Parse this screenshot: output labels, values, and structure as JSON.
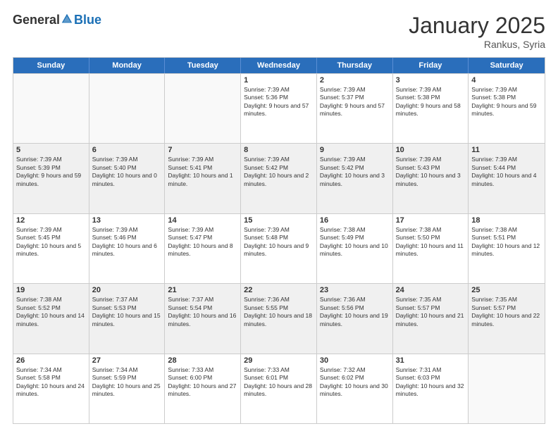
{
  "header": {
    "logo": {
      "general": "General",
      "blue": "Blue"
    },
    "title": "January 2025",
    "location": "Rankus, Syria"
  },
  "weekdays": [
    "Sunday",
    "Monday",
    "Tuesday",
    "Wednesday",
    "Thursday",
    "Friday",
    "Saturday"
  ],
  "rows": [
    [
      {
        "day": "",
        "sunrise": "",
        "sunset": "",
        "daylight": "",
        "empty": true
      },
      {
        "day": "",
        "sunrise": "",
        "sunset": "",
        "daylight": "",
        "empty": true
      },
      {
        "day": "",
        "sunrise": "",
        "sunset": "",
        "daylight": "",
        "empty": true
      },
      {
        "day": "1",
        "sunrise": "Sunrise: 7:39 AM",
        "sunset": "Sunset: 5:36 PM",
        "daylight": "Daylight: 9 hours and 57 minutes."
      },
      {
        "day": "2",
        "sunrise": "Sunrise: 7:39 AM",
        "sunset": "Sunset: 5:37 PM",
        "daylight": "Daylight: 9 hours and 57 minutes."
      },
      {
        "day": "3",
        "sunrise": "Sunrise: 7:39 AM",
        "sunset": "Sunset: 5:38 PM",
        "daylight": "Daylight: 9 hours and 58 minutes."
      },
      {
        "day": "4",
        "sunrise": "Sunrise: 7:39 AM",
        "sunset": "Sunset: 5:38 PM",
        "daylight": "Daylight: 9 hours and 59 minutes."
      }
    ],
    [
      {
        "day": "5",
        "sunrise": "Sunrise: 7:39 AM",
        "sunset": "Sunset: 5:39 PM",
        "daylight": "Daylight: 9 hours and 59 minutes."
      },
      {
        "day": "6",
        "sunrise": "Sunrise: 7:39 AM",
        "sunset": "Sunset: 5:40 PM",
        "daylight": "Daylight: 10 hours and 0 minutes."
      },
      {
        "day": "7",
        "sunrise": "Sunrise: 7:39 AM",
        "sunset": "Sunset: 5:41 PM",
        "daylight": "Daylight: 10 hours and 1 minute."
      },
      {
        "day": "8",
        "sunrise": "Sunrise: 7:39 AM",
        "sunset": "Sunset: 5:42 PM",
        "daylight": "Daylight: 10 hours and 2 minutes."
      },
      {
        "day": "9",
        "sunrise": "Sunrise: 7:39 AM",
        "sunset": "Sunset: 5:42 PM",
        "daylight": "Daylight: 10 hours and 3 minutes."
      },
      {
        "day": "10",
        "sunrise": "Sunrise: 7:39 AM",
        "sunset": "Sunset: 5:43 PM",
        "daylight": "Daylight: 10 hours and 3 minutes."
      },
      {
        "day": "11",
        "sunrise": "Sunrise: 7:39 AM",
        "sunset": "Sunset: 5:44 PM",
        "daylight": "Daylight: 10 hours and 4 minutes."
      }
    ],
    [
      {
        "day": "12",
        "sunrise": "Sunrise: 7:39 AM",
        "sunset": "Sunset: 5:45 PM",
        "daylight": "Daylight: 10 hours and 5 minutes."
      },
      {
        "day": "13",
        "sunrise": "Sunrise: 7:39 AM",
        "sunset": "Sunset: 5:46 PM",
        "daylight": "Daylight: 10 hours and 6 minutes."
      },
      {
        "day": "14",
        "sunrise": "Sunrise: 7:39 AM",
        "sunset": "Sunset: 5:47 PM",
        "daylight": "Daylight: 10 hours and 8 minutes."
      },
      {
        "day": "15",
        "sunrise": "Sunrise: 7:39 AM",
        "sunset": "Sunset: 5:48 PM",
        "daylight": "Daylight: 10 hours and 9 minutes."
      },
      {
        "day": "16",
        "sunrise": "Sunrise: 7:38 AM",
        "sunset": "Sunset: 5:49 PM",
        "daylight": "Daylight: 10 hours and 10 minutes."
      },
      {
        "day": "17",
        "sunrise": "Sunrise: 7:38 AM",
        "sunset": "Sunset: 5:50 PM",
        "daylight": "Daylight: 10 hours and 11 minutes."
      },
      {
        "day": "18",
        "sunrise": "Sunrise: 7:38 AM",
        "sunset": "Sunset: 5:51 PM",
        "daylight": "Daylight: 10 hours and 12 minutes."
      }
    ],
    [
      {
        "day": "19",
        "sunrise": "Sunrise: 7:38 AM",
        "sunset": "Sunset: 5:52 PM",
        "daylight": "Daylight: 10 hours and 14 minutes."
      },
      {
        "day": "20",
        "sunrise": "Sunrise: 7:37 AM",
        "sunset": "Sunset: 5:53 PM",
        "daylight": "Daylight: 10 hours and 15 minutes."
      },
      {
        "day": "21",
        "sunrise": "Sunrise: 7:37 AM",
        "sunset": "Sunset: 5:54 PM",
        "daylight": "Daylight: 10 hours and 16 minutes."
      },
      {
        "day": "22",
        "sunrise": "Sunrise: 7:36 AM",
        "sunset": "Sunset: 5:55 PM",
        "daylight": "Daylight: 10 hours and 18 minutes."
      },
      {
        "day": "23",
        "sunrise": "Sunrise: 7:36 AM",
        "sunset": "Sunset: 5:56 PM",
        "daylight": "Daylight: 10 hours and 19 minutes."
      },
      {
        "day": "24",
        "sunrise": "Sunrise: 7:35 AM",
        "sunset": "Sunset: 5:57 PM",
        "daylight": "Daylight: 10 hours and 21 minutes."
      },
      {
        "day": "25",
        "sunrise": "Sunrise: 7:35 AM",
        "sunset": "Sunset: 5:57 PM",
        "daylight": "Daylight: 10 hours and 22 minutes."
      }
    ],
    [
      {
        "day": "26",
        "sunrise": "Sunrise: 7:34 AM",
        "sunset": "Sunset: 5:58 PM",
        "daylight": "Daylight: 10 hours and 24 minutes."
      },
      {
        "day": "27",
        "sunrise": "Sunrise: 7:34 AM",
        "sunset": "Sunset: 5:59 PM",
        "daylight": "Daylight: 10 hours and 25 minutes."
      },
      {
        "day": "28",
        "sunrise": "Sunrise: 7:33 AM",
        "sunset": "Sunset: 6:00 PM",
        "daylight": "Daylight: 10 hours and 27 minutes."
      },
      {
        "day": "29",
        "sunrise": "Sunrise: 7:33 AM",
        "sunset": "Sunset: 6:01 PM",
        "daylight": "Daylight: 10 hours and 28 minutes."
      },
      {
        "day": "30",
        "sunrise": "Sunrise: 7:32 AM",
        "sunset": "Sunset: 6:02 PM",
        "daylight": "Daylight: 10 hours and 30 minutes."
      },
      {
        "day": "31",
        "sunrise": "Sunrise: 7:31 AM",
        "sunset": "Sunset: 6:03 PM",
        "daylight": "Daylight: 10 hours and 32 minutes."
      },
      {
        "day": "",
        "sunrise": "",
        "sunset": "",
        "daylight": "",
        "empty": true
      }
    ]
  ]
}
